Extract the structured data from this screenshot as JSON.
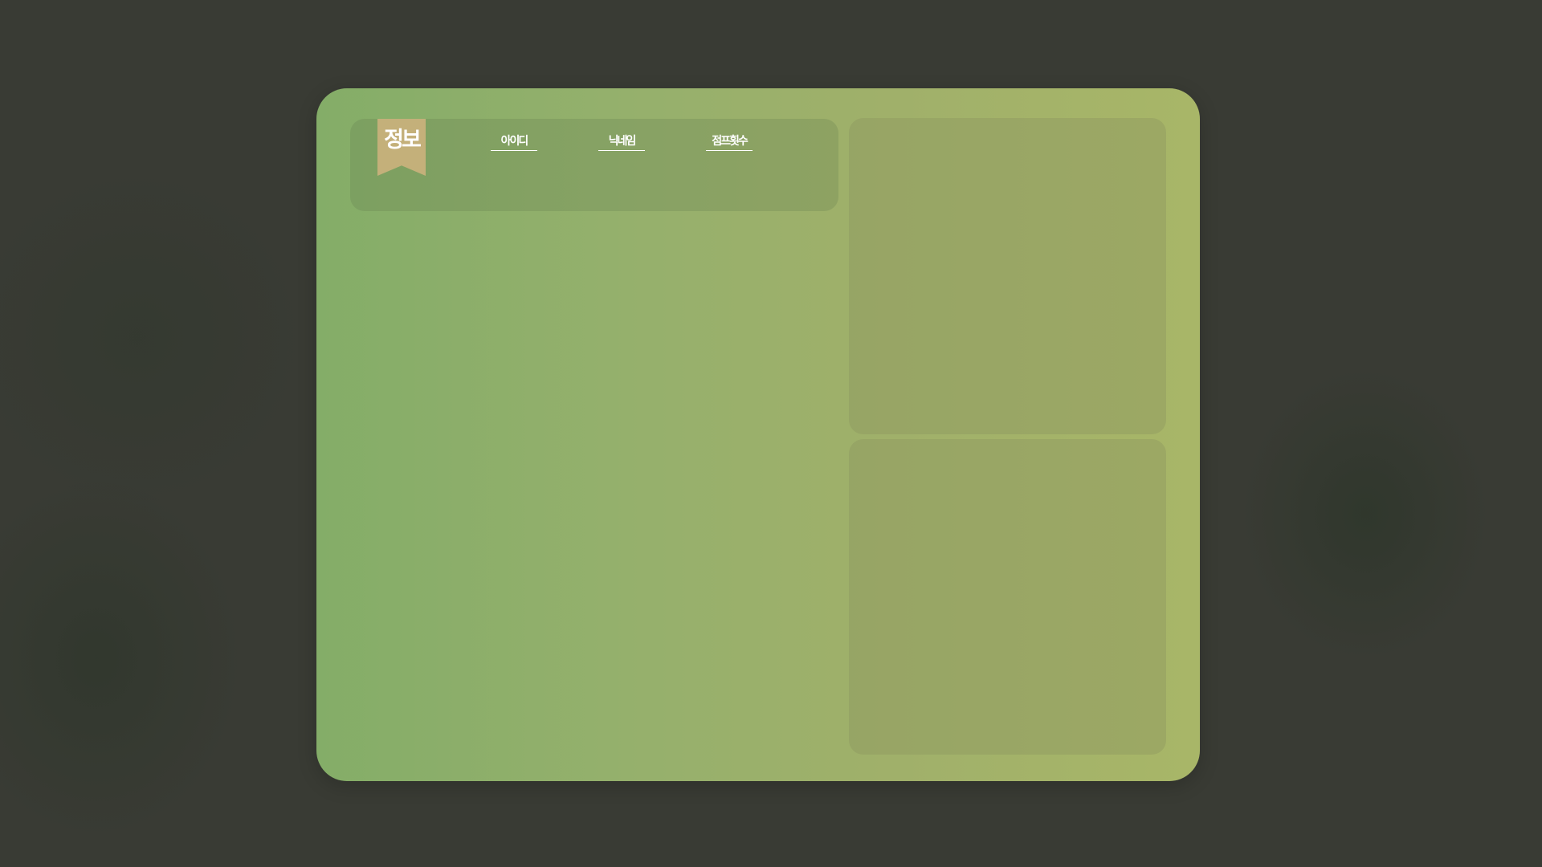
{
  "info_panel": {
    "ribbon_label": "정보",
    "fields": [
      {
        "label": "아이디"
      },
      {
        "label": "닉네임"
      },
      {
        "label": "점프횟수"
      }
    ]
  },
  "colors": {
    "background": "#393b34",
    "panel_gradient_start": "#84ad68",
    "panel_gradient_end": "#a8b668",
    "ribbon": "#c4b07a",
    "text": "#ffffff"
  }
}
